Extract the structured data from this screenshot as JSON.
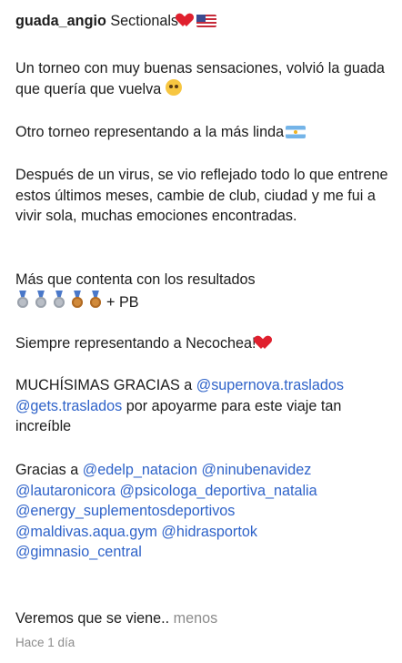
{
  "post": {
    "username": "guada_angio",
    "title": "Sectionals",
    "para1": "Un torneo con muy buenas sensaciones, volvió la guada que quería que vuelva",
    "para2": "Otro torneo representando a la más linda",
    "para3": "Después de un virus, se vio reflejado todo lo que entrene estos últimos meses, cambie de club, ciudad y me fui a vivir sola, muchas emociones encontradas.",
    "para4": "Más que contenta con los resultados",
    "pb": "+ PB",
    "para5": "Siempre representando a Necochea!",
    "thanks1_pre": "MUCHÍSIMAS GRACIAS a ",
    "thanks1_mid": " por apoyarme para este viaje tan increíble",
    "thanks2_pre": "Gracias a ",
    "closing": "Veremos que se viene..",
    "less": "menos"
  },
  "mentions": {
    "supernova": "@supernova.traslados",
    "gets": "@gets.traslados",
    "edelp": "@edelp_natacion",
    "ninu": "@ninubenavidez",
    "lautaro": "@lautaronicora",
    "psicologa": "@psicologa_deportiva_natalia",
    "energy": "@energy_suplementosdeportivos",
    "maldivas": "@maldivas.aqua.gym",
    "hidra": "@hidrasportok",
    "gimnasio": "@gimnasio_central"
  },
  "meta": {
    "time": "Hace 1 día"
  },
  "icons": [
    "red-heart-icon",
    "us-flag-icon",
    "pleading-face-icon",
    "argentina-flag-icon",
    "silver-medal-icon",
    "bronze-medal-icon"
  ],
  "colors": {
    "mention": "#2f63c9",
    "muted": "#8c8c8c",
    "text": "#1c1c1c"
  }
}
